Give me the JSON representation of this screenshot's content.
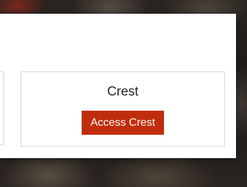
{
  "card": {
    "title": "Crest",
    "button_label": "Access Crest",
    "button_color": "#c02d0c"
  }
}
